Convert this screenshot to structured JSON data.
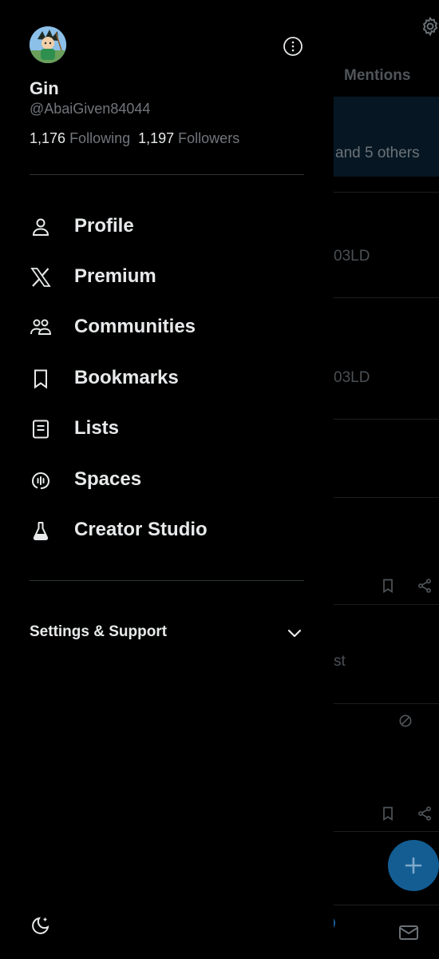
{
  "background": {
    "tab_mentions": "Mentions",
    "notif_others": "and 5 others",
    "row_text_1": "03LD",
    "row_text_2": "03LD",
    "row_text_3": "st",
    "fab_icon": "plus-icon",
    "accent": "#1d9bf0"
  },
  "profile": {
    "name": "Gin",
    "handle": "@AbaiGiven84044",
    "following_count": "1,176",
    "following_label": "Following",
    "followers_count": "1,197",
    "followers_label": "Followers"
  },
  "menu": [
    {
      "label": "Profile",
      "icon": "person-icon"
    },
    {
      "label": "Premium",
      "icon": "x-logo-icon"
    },
    {
      "label": "Communities",
      "icon": "communities-icon"
    },
    {
      "label": "Bookmarks",
      "icon": "bookmark-icon"
    },
    {
      "label": "Lists",
      "icon": "lists-icon"
    },
    {
      "label": "Spaces",
      "icon": "spaces-icon"
    },
    {
      "label": "Creator Studio",
      "icon": "flask-icon"
    }
  ],
  "settings": {
    "label": "Settings & Support"
  },
  "colors": {
    "text": "#e7e9ea",
    "muted": "#71767b",
    "divider": "#2f3336",
    "background": "#000000"
  }
}
